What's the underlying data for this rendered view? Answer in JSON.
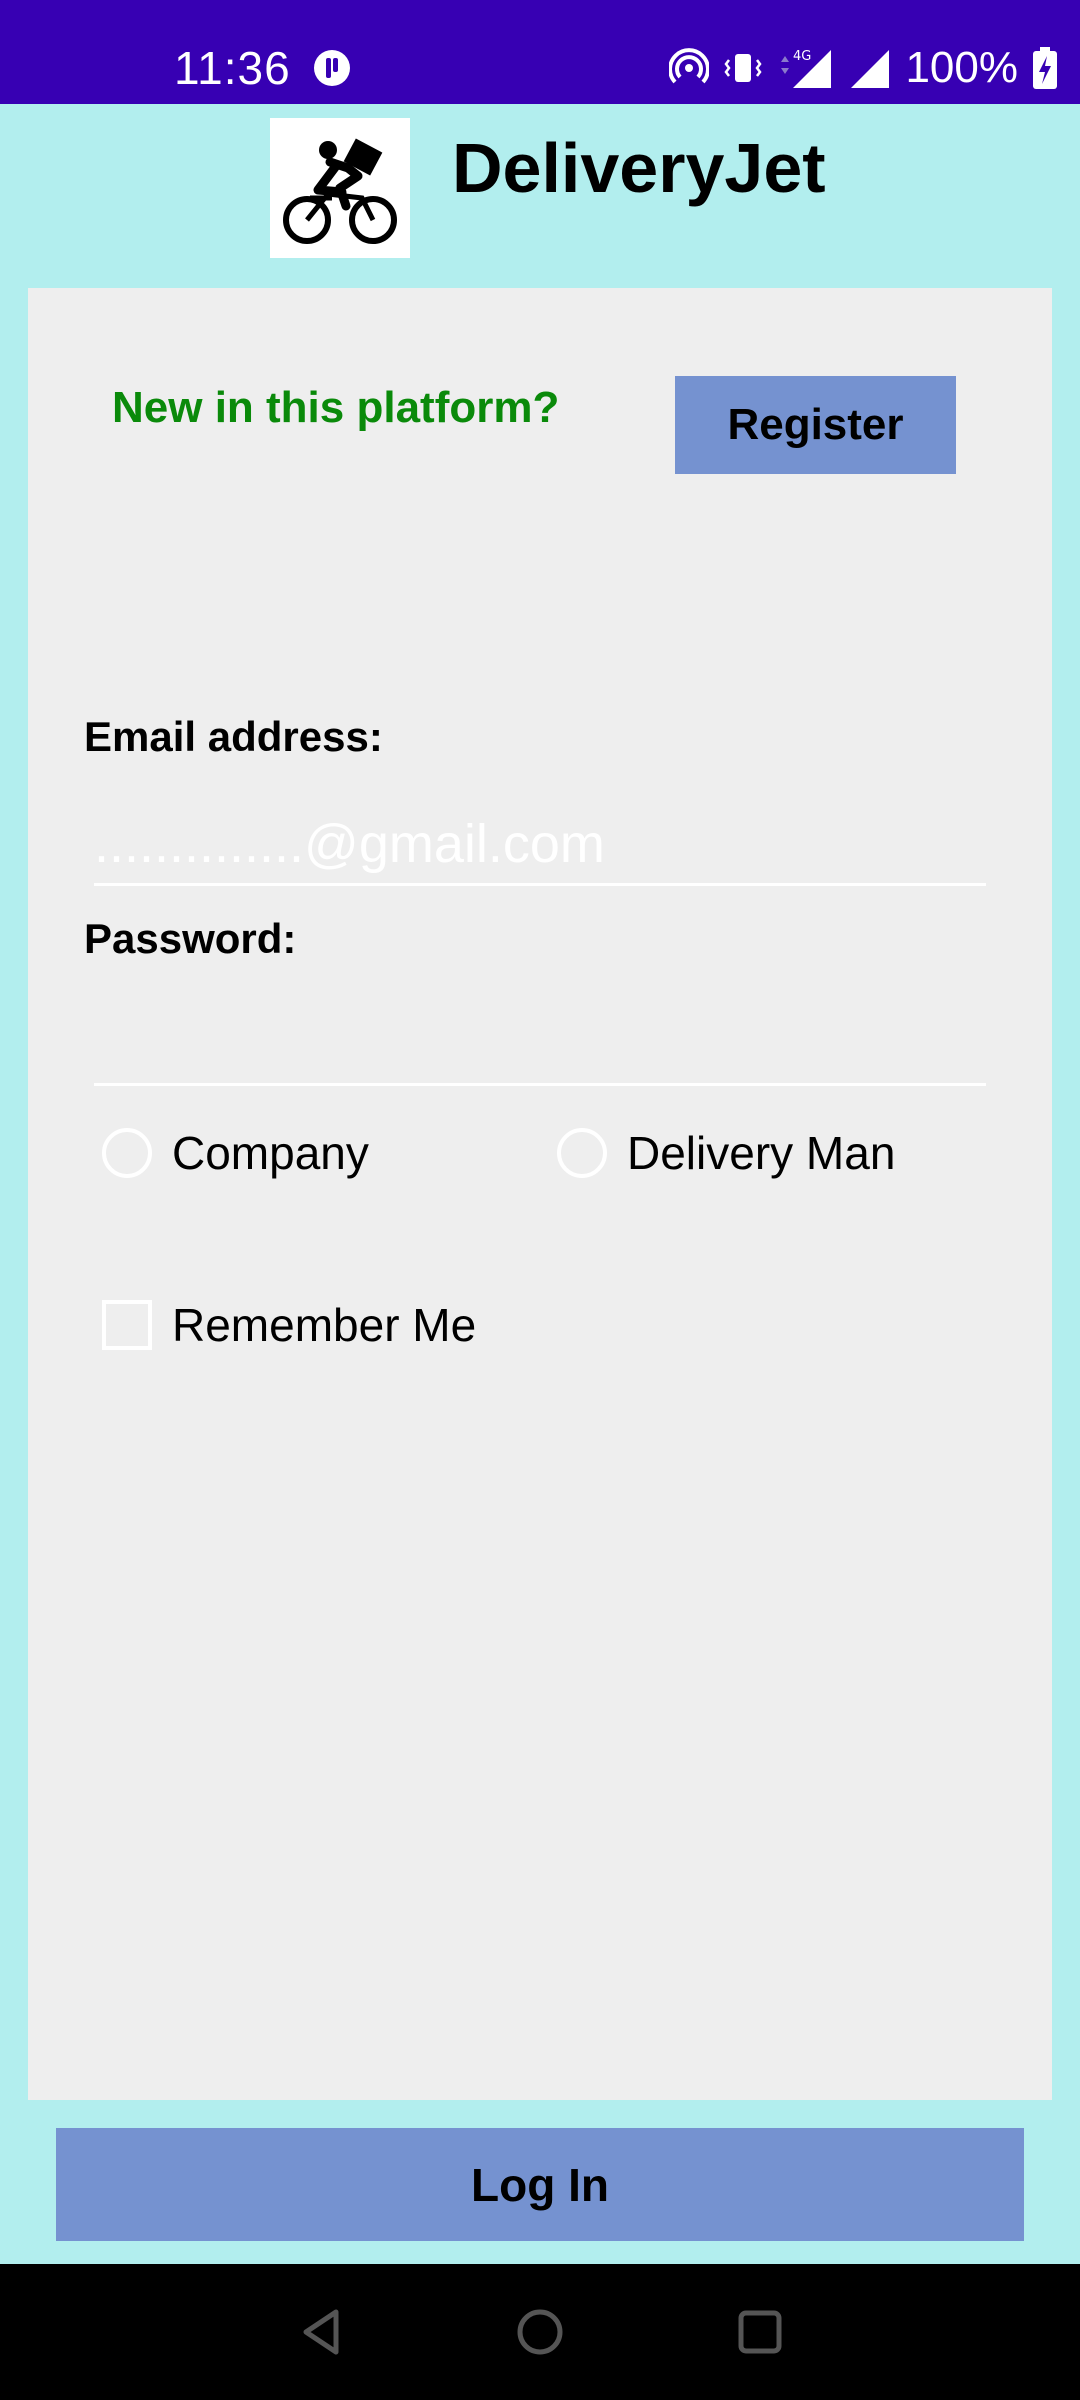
{
  "status_bar": {
    "time": "11:36",
    "battery_percent": "100%",
    "network_type": "4G",
    "background_color": "#3700b3",
    "icons": [
      "app-notification-icon",
      "hotspot-icon",
      "vibrate-icon",
      "signal-4g-icon",
      "signal-icon",
      "battery-charging-icon"
    ]
  },
  "header": {
    "app_title": "DeliveryJet",
    "logo_icon": "bicycle-courier-icon"
  },
  "register_section": {
    "prompt": "New in this platform?",
    "register_label": "Register"
  },
  "form": {
    "email_label": "Email address:",
    "email_placeholder": "..............@gmail.com",
    "email_value": "",
    "password_label": "Password:",
    "password_value": "",
    "role_options": [
      {
        "label": "Company",
        "selected": false
      },
      {
        "label": "Delivery Man",
        "selected": false
      }
    ],
    "remember_label": "Remember Me",
    "remember_checked": false
  },
  "login_label": "Log In",
  "nav_bar": {
    "icons": [
      "back-icon",
      "home-icon",
      "recents-icon"
    ]
  },
  "colors": {
    "background": "#b2eeee",
    "card": "#eeeeee",
    "button": "#7592d0",
    "prompt_text": "#0a8a0a"
  }
}
